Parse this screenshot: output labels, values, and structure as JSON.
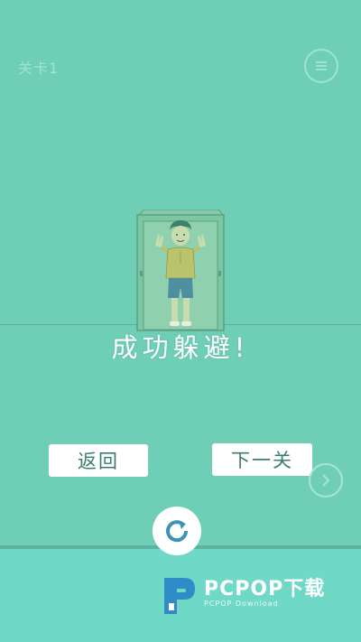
{
  "hud": {
    "level_label": "关卡1",
    "menu_icon": "menu-icon"
  },
  "result": {
    "message": "成功躲避!"
  },
  "buttons": {
    "back_label": "返回",
    "next_label": "下一关",
    "next_arrow_icon": "chevron-right-icon",
    "retry_icon": "retry-icon"
  },
  "watermark": {
    "brand": "PCPOP下载",
    "sub": "PCPOP Download"
  },
  "colors": {
    "background": "#6fcfb6",
    "bottom_band": "#6fd8c6",
    "button_text": "#3a7d70",
    "retry_icon": "#3d93b3"
  }
}
